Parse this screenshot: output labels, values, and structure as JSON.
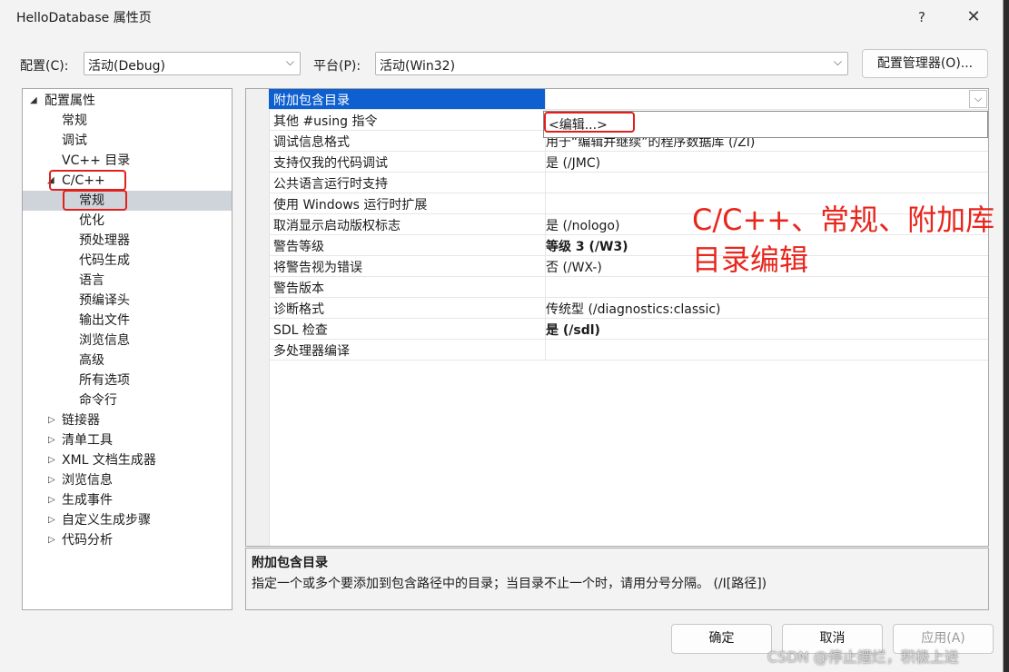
{
  "window": {
    "title": "HelloDatabase 属性页",
    "help": "?",
    "close": "✕"
  },
  "config": {
    "label": "配置(C):",
    "value": "活动(Debug)"
  },
  "platform": {
    "label": "平台(P):",
    "value": "活动(Win32)"
  },
  "config_manager_button": "配置管理器(O)...",
  "tree": {
    "root": "配置属性",
    "general": "常规",
    "debugging": "调试",
    "vc_dirs": "VC++ 目录",
    "cpp": "C/C++",
    "cpp_children": [
      "常规",
      "优化",
      "预处理器",
      "代码生成",
      "语言",
      "预编译头",
      "输出文件",
      "浏览信息",
      "高级",
      "所有选项",
      "命令行"
    ],
    "others": [
      "链接器",
      "清单工具",
      "XML 文档生成器",
      "浏览信息",
      "生成事件",
      "自定义生成步骤",
      "代码分析"
    ]
  },
  "grid": {
    "rows": [
      {
        "name": "附加包含目录",
        "value": ""
      },
      {
        "name": "其他 #using 指令",
        "value": ""
      },
      {
        "name": "调试信息格式",
        "value": "用于“编辑并继续”的程序数据库 (/ZI)"
      },
      {
        "name": "支持仅我的代码调试",
        "value": "是 (/JMC)"
      },
      {
        "name": "公共语言运行时支持",
        "value": ""
      },
      {
        "name": "使用 Windows 运行时扩展",
        "value": ""
      },
      {
        "name": "取消显示启动版权标志",
        "value": "是 (/nologo)"
      },
      {
        "name": "警告等级",
        "value": "等级 3 (/W3)"
      },
      {
        "name": "将警告视为错误",
        "value": "否 (/WX-)"
      },
      {
        "name": "警告版本",
        "value": ""
      },
      {
        "name": "诊断格式",
        "value": "传统型 (/diagnostics:classic)"
      },
      {
        "name": "SDL 检查",
        "value": "是 (/sdl)"
      },
      {
        "name": "多处理器编译",
        "value": ""
      }
    ],
    "dropdown_item": "<编辑...>"
  },
  "annotation": "C/C++、常规、附加库目录编辑",
  "description": {
    "title": "附加包含目录",
    "text": "指定一个或多个要添加到包含路径中的目录；当目录不止一个时，请用分号分隔。     (/I[路径])"
  },
  "buttons": {
    "ok": "确定",
    "cancel": "取消",
    "apply": "应用(A)"
  },
  "watermark": "CSDN @停止摆烂，积极上进",
  "colors": {
    "selection": "#0e5fcf",
    "highlight": "#e0201c",
    "annotation": "#e8261d"
  }
}
